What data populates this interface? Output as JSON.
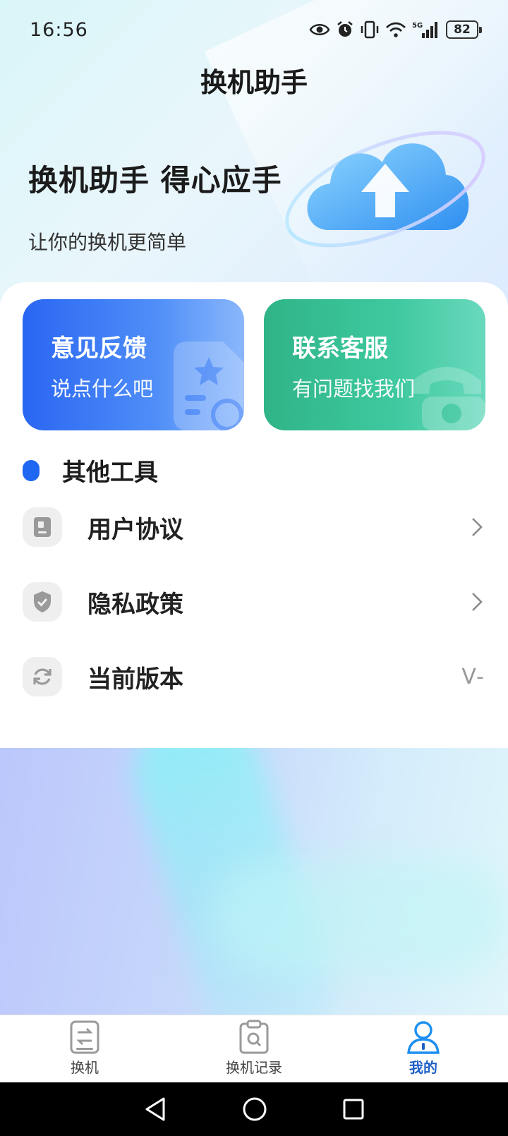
{
  "status_bar": {
    "time": "16:56",
    "battery": "82",
    "network": "5G"
  },
  "header": {
    "title": "换机助手"
  },
  "hero": {
    "heading": "换机助手 得心应手",
    "subtitle": "让你的换机更简单"
  },
  "cards": {
    "feedback": {
      "title": "意见反馈",
      "subtitle": "说点什么吧"
    },
    "service": {
      "title": "联系客服",
      "subtitle": "有问题找我们"
    }
  },
  "tools": {
    "section_title": "其他工具",
    "items": [
      {
        "label": "用户协议",
        "icon": "document-icon"
      },
      {
        "label": "隐私政策",
        "icon": "shield-icon"
      },
      {
        "label": "当前版本",
        "icon": "refresh-icon",
        "value": "V-"
      }
    ]
  },
  "tab_bar": {
    "items": [
      {
        "label": "换机",
        "icon": "switch-phone-icon",
        "active": false
      },
      {
        "label": "换机记录",
        "icon": "clipboard-search-icon",
        "active": false
      },
      {
        "label": "我的",
        "icon": "person-icon",
        "active": true
      }
    ]
  },
  "colors": {
    "feedback_card": "#2a66f2",
    "service_card": "#2fb487",
    "accent": "#1f66f0",
    "active_tab": "#1d5fc7"
  }
}
